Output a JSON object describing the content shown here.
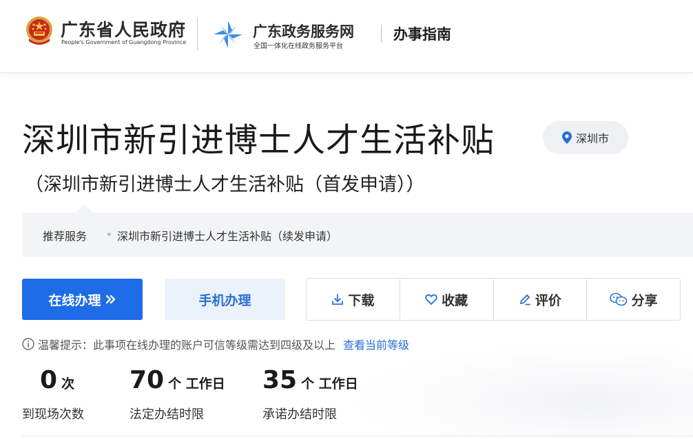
{
  "header": {
    "gov_name_cn": "广东省人民政府",
    "gov_name_en": "People's Government of Guangdong Province",
    "service_name_cn": "广东政务服务网",
    "service_subtitle": "全国一体化在线政务服务平台",
    "section_title": "办事指南"
  },
  "service": {
    "title": "深圳市新引进博士人才生活补贴",
    "subtitle": "（深圳市新引进博士人才生活补贴（首发申请））",
    "region": "深圳市"
  },
  "recommend": {
    "label": "推荐服务",
    "items": [
      "深圳市新引进博士人才生活补贴（续发申请）"
    ]
  },
  "actions": {
    "online_label": "在线办理",
    "mobile_label": "手机办理",
    "download_label": "下载",
    "favorite_label": "收藏",
    "review_label": "评价",
    "share_label": "分享"
  },
  "tip": {
    "text": "温馨提示：此事项在线办理的账户可信等级需达到四级及以上",
    "link": "查看当前等级"
  },
  "stats": [
    {
      "value": "0",
      "unit": "次",
      "label": "到现场次数"
    },
    {
      "value": "70",
      "unit": "个 工作日",
      "label": "法定办结时限"
    },
    {
      "value": "35",
      "unit": "个 工作日",
      "label": "承诺办结时限"
    }
  ],
  "colors": {
    "primary": "#1e6ce8",
    "primary_light": "#eaf2fc",
    "link": "#2a6fd6"
  }
}
